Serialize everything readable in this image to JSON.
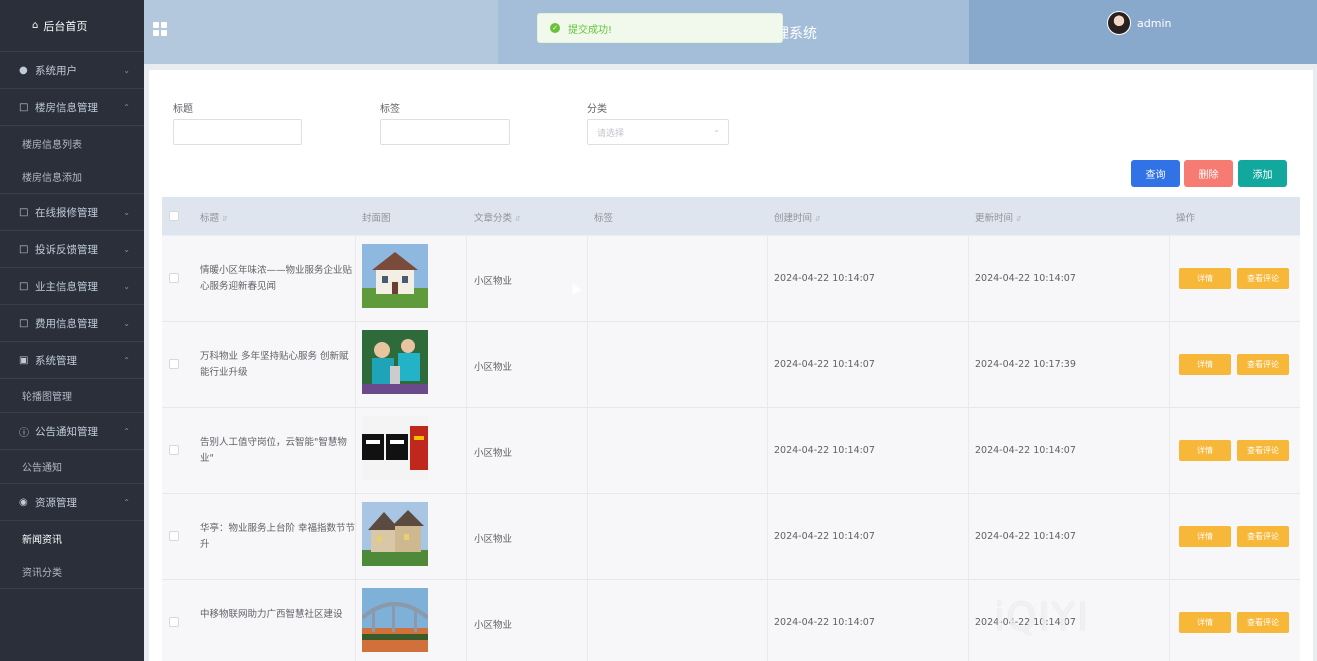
{
  "sidebar": {
    "home": "后台首页",
    "groups": [
      {
        "label": "系统用户",
        "icon": "user-icon",
        "expanded": false
      },
      {
        "label": "楼房信息管理",
        "icon": "document-icon",
        "expanded": true,
        "children": [
          "楼房信息列表",
          "楼房信息添加"
        ]
      },
      {
        "label": "在线报修管理",
        "icon": "document-icon",
        "expanded": false
      },
      {
        "label": "投诉反馈管理",
        "icon": "document-icon",
        "expanded": false
      },
      {
        "label": "业主信息管理",
        "icon": "document-icon",
        "expanded": false
      },
      {
        "label": "费用信息管理",
        "icon": "document-icon",
        "expanded": false
      },
      {
        "label": "系统管理",
        "icon": "picture-icon",
        "expanded": true,
        "children": [
          "轮播图管理"
        ]
      },
      {
        "label": "公告通知管理",
        "icon": "info-icon",
        "expanded": true,
        "children": [
          "公告通知"
        ]
      },
      {
        "label": "资源管理",
        "icon": "location-icon",
        "expanded": true,
        "children": [
          "新闻资讯",
          "资讯分类"
        ]
      }
    ],
    "active_item": "新闻资讯"
  },
  "header": {
    "title": "理系统",
    "username": "admin"
  },
  "toast": {
    "message": "提交成功!"
  },
  "filters": {
    "title_label": "标题",
    "tag_label": "标签",
    "category_label": "分类",
    "category_placeholder": "请选择"
  },
  "buttons": {
    "query": "查询",
    "delete": "删除",
    "add": "添加"
  },
  "table": {
    "headers": [
      "标题",
      "封面图",
      "文章分类",
      "标签",
      "创建时间",
      "更新时间",
      "操作"
    ],
    "rows": [
      {
        "title": "情暖小区年味浓——物业服务企业贴心服务迎新春见闻",
        "category": "小区物业",
        "tag": "",
        "created": "2024-04-22 10:14:07",
        "updated": "2024-04-22 10:14:07",
        "cover": "house-image"
      },
      {
        "title": "万科物业 多年坚持贴心服务 创新赋能行业升级",
        "category": "小区物业",
        "tag": "",
        "created": "2024-04-22 10:14:07",
        "updated": "2024-04-22 10:17:39",
        "cover": "workers-image"
      },
      {
        "title": "告别人工值守岗位，云智能\"智慧物业\"",
        "category": "小区物业",
        "tag": "",
        "created": "2024-04-22 10:14:07",
        "updated": "2024-04-22 10:14:07",
        "cover": "property-text-image"
      },
      {
        "title": "华亭：物业服务上台阶 幸福指数节节升",
        "category": "小区物业",
        "tag": "",
        "created": "2024-04-22 10:14:07",
        "updated": "2024-04-22 10:14:07",
        "cover": "villa-image"
      },
      {
        "title": "中移物联网助力广西智慧社区建设",
        "category": "小区物业",
        "tag": "",
        "created": "2024-04-22 10:14:07",
        "updated": "2024-04-22 10:14:07",
        "cover": "bridge-image"
      }
    ],
    "action_detail": "详情",
    "action_comment": "查看评论"
  },
  "watermark": "iQIYI",
  "colors": {
    "sidebar_bg": "#2b2f3a",
    "query_btn": "#3172e6",
    "delete_btn": "#f57b73",
    "add_btn": "#13a89e",
    "action_btn": "#f7b739",
    "toast_text": "#67c23a"
  }
}
